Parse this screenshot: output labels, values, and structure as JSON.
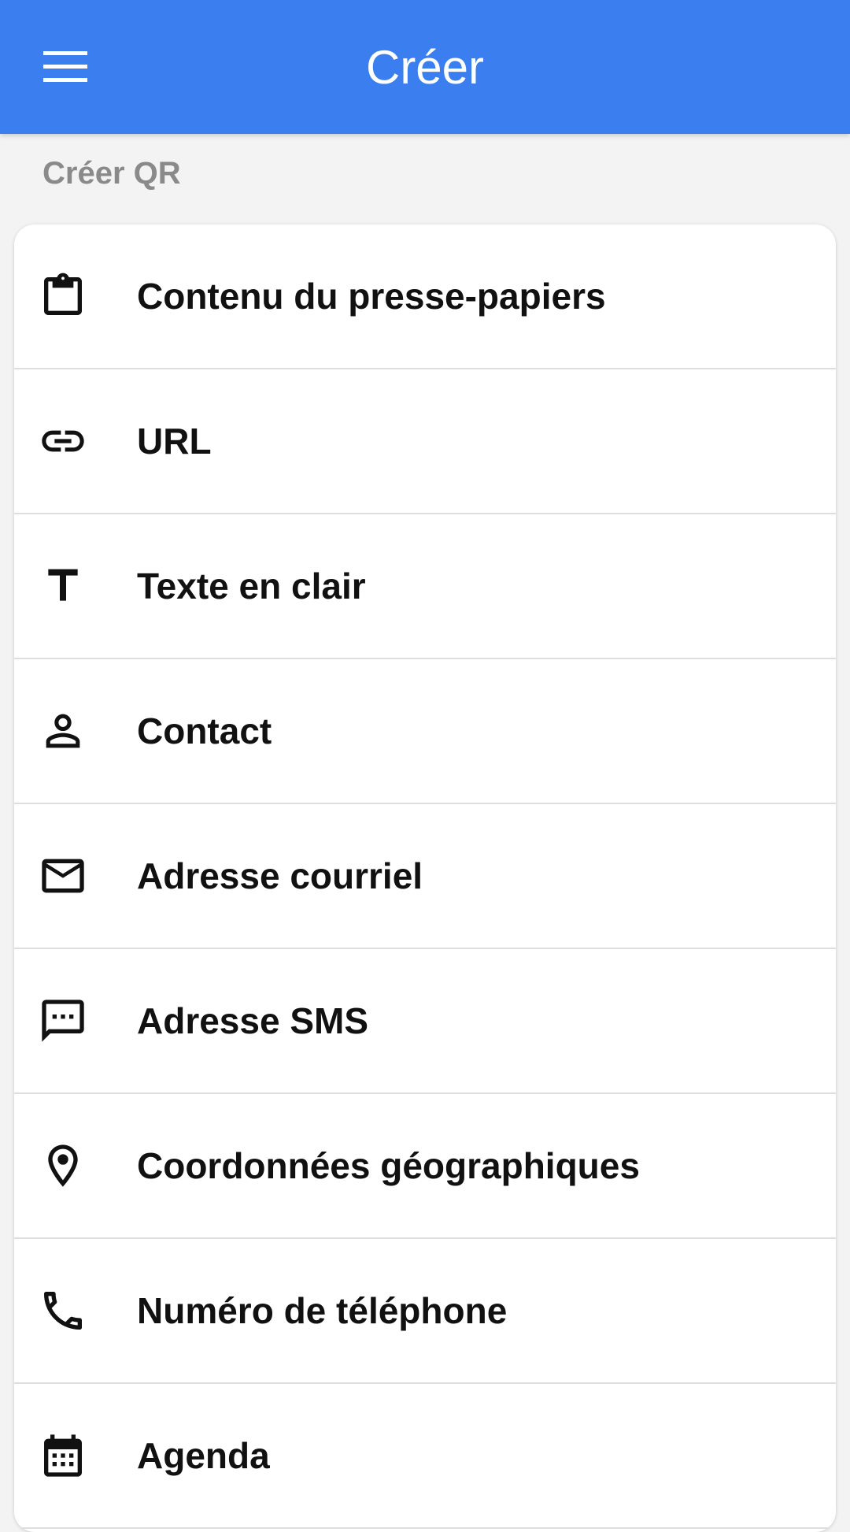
{
  "appbar": {
    "title": "Créer",
    "menu_icon": "hamburger-menu-icon",
    "background_color": "#3a7ef0"
  },
  "section": {
    "header": "Créer QR"
  },
  "items": [
    {
      "label": "Contenu du presse-papiers",
      "icon": "clipboard-icon"
    },
    {
      "label": "URL",
      "icon": "link-icon"
    },
    {
      "label": "Texte en clair",
      "icon": "text-icon"
    },
    {
      "label": "Contact",
      "icon": "person-icon"
    },
    {
      "label": "Adresse courriel",
      "icon": "email-icon"
    },
    {
      "label": "Adresse SMS",
      "icon": "sms-icon"
    },
    {
      "label": "Coordonnées géographiques",
      "icon": "location-pin-icon"
    },
    {
      "label": "Numéro de téléphone",
      "icon": "phone-icon"
    },
    {
      "label": "Agenda",
      "icon": "calendar-icon"
    }
  ]
}
